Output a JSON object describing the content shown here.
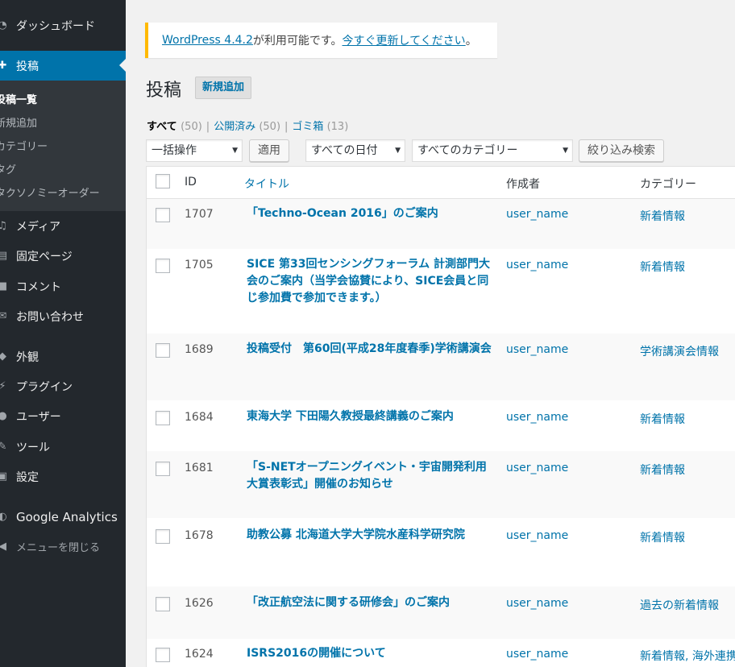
{
  "sidebar": {
    "items": [
      {
        "label": "ダッシュボード",
        "icon": "dashboard-icon"
      },
      {
        "label": "投稿",
        "icon": "pin-icon"
      },
      {
        "label": "メディア",
        "icon": "media-icon"
      },
      {
        "label": "固定ページ",
        "icon": "page-icon"
      },
      {
        "label": "コメント",
        "icon": "comment-icon"
      },
      {
        "label": "お問い合わせ",
        "icon": "mail-icon"
      },
      {
        "label": "外観",
        "icon": "appearance-icon"
      },
      {
        "label": "プラグイン",
        "icon": "plugin-icon"
      },
      {
        "label": "ユーザー",
        "icon": "user-icon"
      },
      {
        "label": "ツール",
        "icon": "tool-icon"
      },
      {
        "label": "設定",
        "icon": "settings-icon"
      },
      {
        "label": "Google Analytics",
        "icon": "analytics-icon"
      },
      {
        "label": "メニューを閉じる",
        "icon": "collapse-icon"
      }
    ],
    "submenu": [
      "投稿一覧",
      "新規追加",
      "カテゴリー",
      "タグ",
      "タクソノミーオーダー"
    ]
  },
  "notice": {
    "version_link": "WordPress 4.4.2",
    "middle_text": " が利用可能です。",
    "update_link": "今すぐ更新してください",
    "end_text": "。"
  },
  "header": {
    "title": "投稿",
    "add_new": "新規追加"
  },
  "views": [
    {
      "label": "すべて",
      "count": "(50)"
    },
    {
      "label": "公開済み",
      "count": "(50)"
    },
    {
      "label": "ゴミ箱",
      "count": "(13)"
    }
  ],
  "views_sep": "|",
  "controls": {
    "bulk_action": "一括操作",
    "apply": "適用",
    "date_filter": "すべての日付",
    "category_filter": "すべてのカテゴリー",
    "filter_button": "絞り込み検索",
    "caret": "▼"
  },
  "table": {
    "columns": {
      "id": "ID",
      "title": "タイトル",
      "author": "作成者",
      "categories": "カテゴリー"
    },
    "rows": [
      {
        "id": "1707",
        "title": "「Techno-Ocean 2016」のご案内",
        "author": "user_name",
        "category": "新着情報"
      },
      {
        "id": "1705",
        "title": "SICE 第33回センシングフォーラム 計測部門大会のご案内（当学会協賛により、SICE会員と同じ参加費で参加できます。）",
        "author": "user_name",
        "category": "新着情報"
      },
      {
        "id": "1689",
        "title": "投稿受付　第60回(平成28年度春季)学術講演会",
        "author": "user_name",
        "category": "学術講演会情報"
      },
      {
        "id": "1684",
        "title": "東海大学 下田陽久教授最終講義のご案内",
        "author": "user_name",
        "category": "新着情報"
      },
      {
        "id": "1681",
        "title": "「S-NETオープニングイベント・宇宙開発利用大賞表彰式」開催のお知らせ",
        "author": "user_name",
        "category": "新着情報"
      },
      {
        "id": "1678",
        "title": "助教公募 北海道大学大学院水産科学研究院",
        "author": "user_name",
        "category": "新着情報"
      },
      {
        "id": "1626",
        "title": "「改正航空法に関する研修会」のご案内",
        "author": "user_name",
        "category": "過去の新着情報"
      },
      {
        "id": "1624",
        "title": "ISRS2016の開催について",
        "author": "user_name",
        "category": "新着情報, 海外連携"
      }
    ]
  },
  "colors": {
    "accent": "#0073aa",
    "sidebar": "#23282d",
    "notice": "#ffb900"
  }
}
